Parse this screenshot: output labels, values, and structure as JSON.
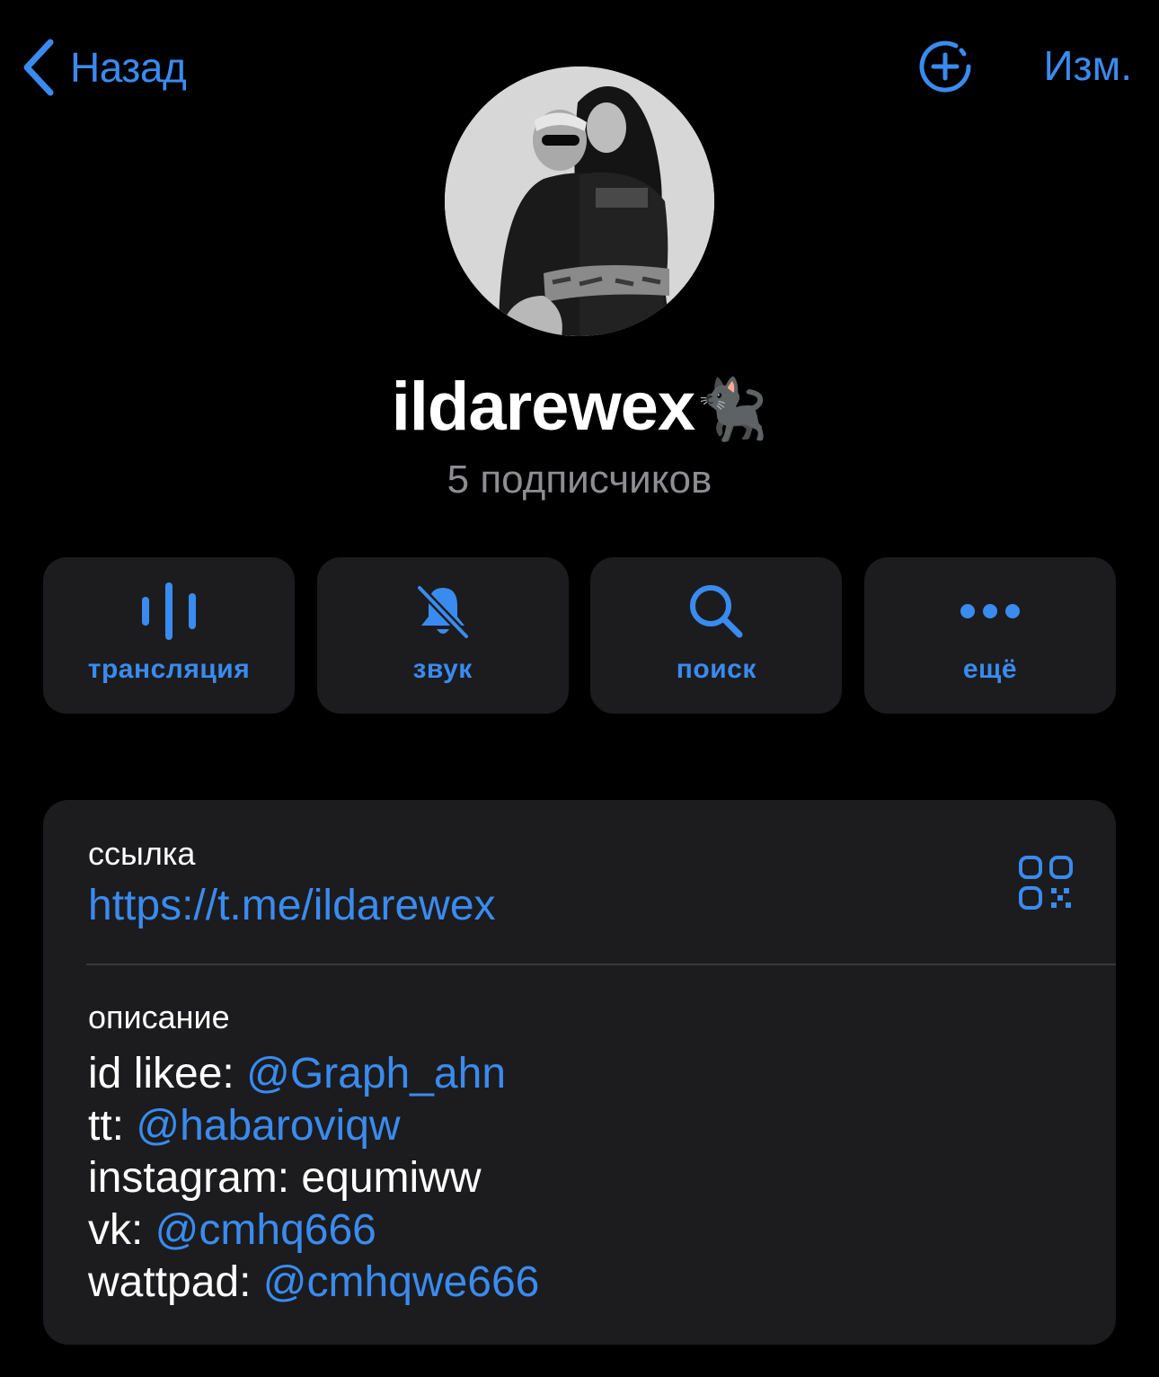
{
  "nav": {
    "back_label": "Назад",
    "edit_label": "Изм."
  },
  "profile": {
    "name": "ildarewex",
    "name_emoji": "🐈‍⬛",
    "subscribers": "5 подписчиков"
  },
  "actions": [
    {
      "icon": "broadcast-waveform-icon",
      "label": "трансляция"
    },
    {
      "icon": "bell-slash-icon",
      "label": "звук"
    },
    {
      "icon": "search-icon",
      "label": "поиск"
    },
    {
      "icon": "ellipsis-icon",
      "label": "ещё"
    }
  ],
  "info": {
    "link_label": "ссылка",
    "link_value": "https://t.me/ildarewex",
    "description_label": "описание",
    "description_lines": [
      {
        "key": "id likee: ",
        "value": "@Graph_ahn",
        "value_is_link": true
      },
      {
        "key": "tt: ",
        "value": "@habaroviqw",
        "value_is_link": true
      },
      {
        "key": "instagram: ",
        "value": "equmiww",
        "value_is_link": false
      },
      {
        "key": "vk: ",
        "value": "@cmhq666",
        "value_is_link": true
      },
      {
        "key": "wattpad: ",
        "value": "@cmhqwe666",
        "value_is_link": true
      }
    ]
  },
  "colors": {
    "accent": "#3a8bf0",
    "background": "#000000",
    "card": "#1c1c1e",
    "secondary_text": "#8d8d93"
  }
}
